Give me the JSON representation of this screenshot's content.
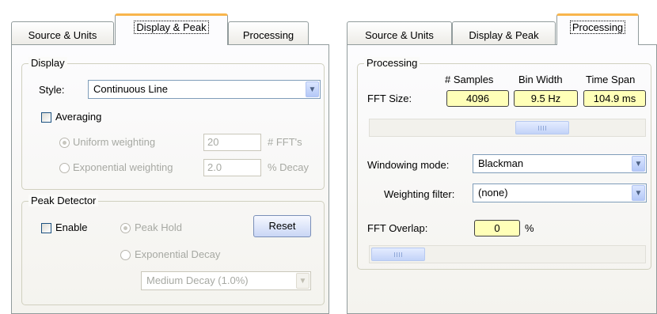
{
  "left": {
    "tabs": [
      "Source & Units",
      "Display & Peak",
      "Processing"
    ],
    "display": {
      "legend": "Display",
      "style_label": "Style:",
      "style_value": "Continuous Line",
      "averaging_label": "Averaging",
      "uniform_label": "Uniform weighting",
      "uniform_value": "20",
      "uniform_unit": "# FFT's",
      "exponential_label": "Exponential weighting",
      "exponential_value": "2.0",
      "exponential_unit": "% Decay"
    },
    "peak": {
      "legend": "Peak Detector",
      "enable_label": "Enable",
      "peak_hold_label": "Peak Hold",
      "reset_label": "Reset",
      "exp_decay_label": "Exponential Decay",
      "decay_select": "Medium Decay (1.0%)"
    }
  },
  "right": {
    "tabs": [
      "Source & Units",
      "Display & Peak",
      "Processing"
    ],
    "processing": {
      "legend": "Processing",
      "col_samples": "# Samples",
      "col_binwidth": "Bin Width",
      "col_timespan": "Time Span",
      "fft_size_label": "FFT Size:",
      "samples_value": "4096",
      "binwidth_value": "9.5 Hz",
      "timespan_value": "104.9 ms",
      "windowing_label": "Windowing mode:",
      "windowing_value": "Blackman",
      "weighting_label": "Weighting filter:",
      "weighting_value": "(none)",
      "overlap_label": "FFT Overlap:",
      "overlap_value": "0",
      "overlap_unit": "%"
    }
  },
  "colors": {
    "tab_highlight": "#f8b54c",
    "field_yellow": "#ffffb8",
    "dropdown_blue": "#b4c8f7"
  },
  "icons": {
    "dropdown": "chevron-down-icon",
    "slider_grip": "grip-icon"
  }
}
